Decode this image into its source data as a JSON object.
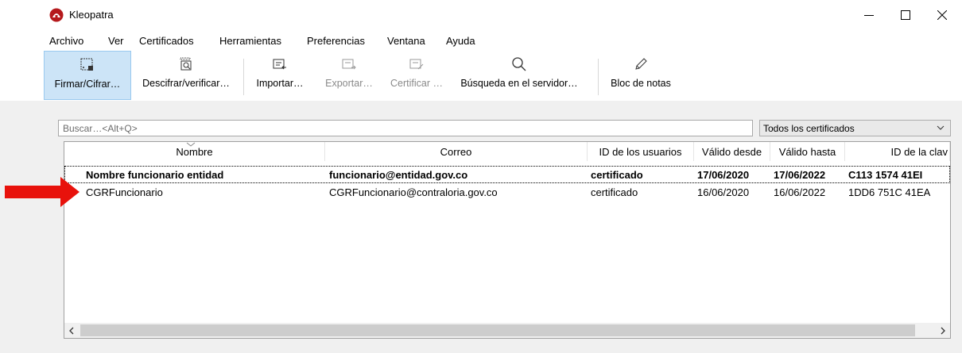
{
  "window": {
    "title": "Kleopatra",
    "minimize_icon": "minimize-icon",
    "maximize_icon": "maximize-icon",
    "close_icon": "close-icon"
  },
  "menu": [
    "Archivo",
    "Ver",
    "Certificados",
    "Herramientas",
    "Preferencias",
    "Ventana",
    "Ayuda"
  ],
  "toolbar": {
    "sign": "Firmar/Cifrar…",
    "decrypt": "Descifrar/verificar…",
    "import": "Importar…",
    "export": "Exportar…",
    "certify": "Certificar …",
    "server_search": "Búsqueda en el servidor…",
    "notepad": "Bloc de notas"
  },
  "search": {
    "placeholder": "Buscar…<Alt+Q>"
  },
  "filter": {
    "selected": "Todos los certificados"
  },
  "table": {
    "headers": [
      "Nombre",
      "Correo",
      "ID de los usuarios",
      "Válido desde",
      "Válido hasta",
      "ID de la clav"
    ],
    "rows": [
      {
        "name": "Nombre funcionario entidad",
        "email": "funcionario@entidad.gov.co",
        "user_id": "certificado",
        "from": "17/06/2020",
        "until": "17/06/2022",
        "key_id": "C113 1574 41EI"
      },
      {
        "name": "CGRFuncionario",
        "email": "CGRFuncionario@contraloria.gov.co",
        "user_id": "certificado",
        "from": "16/06/2020",
        "until": "16/06/2022",
        "key_id": "1DD6 751C 41EA"
      }
    ]
  },
  "colors": {
    "accent": "#cce4f7",
    "annotation_arrow": "#e8120c",
    "app_icon": "#b5191c"
  }
}
